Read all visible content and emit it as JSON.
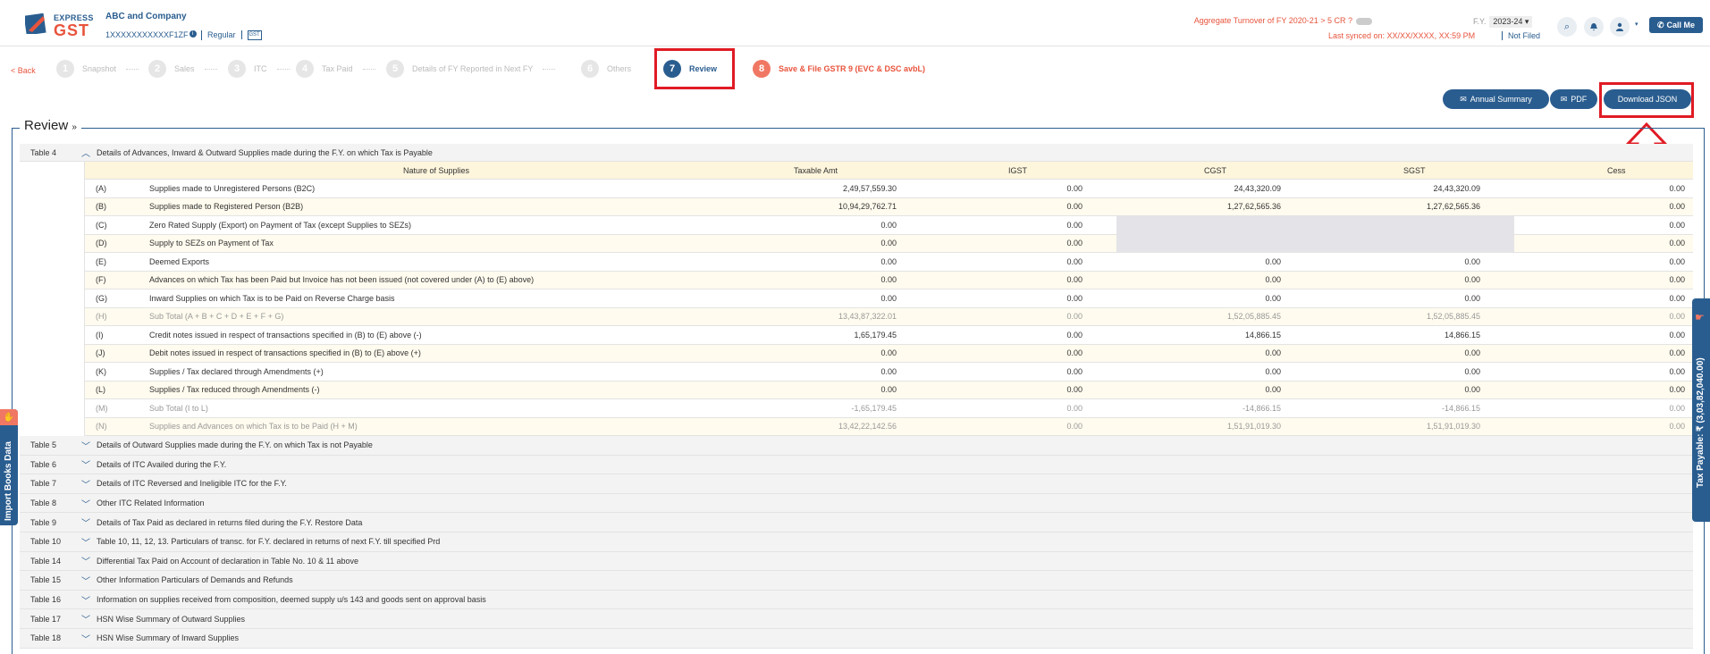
{
  "header": {
    "brand_express": "EXPRESS",
    "brand_gst": "GST",
    "company": "ABC and Company",
    "gstin": "1XXXXXXXXXXXF1ZF",
    "gstin_badge": "i",
    "type": "Regular",
    "gst_mini": "GST",
    "aggregate": "Aggregate Turnover of FY 2020-21 > 5 CR ?",
    "fy_label": "F.Y.",
    "fy_value": "2023-24",
    "synced": "Last synced on: XX/XX/XXXX, XX:59 PM",
    "status": "Not Filed",
    "call_me": "Call Me"
  },
  "stepper": {
    "back": "< Back",
    "steps": [
      {
        "num": "1",
        "label": "Snapshot"
      },
      {
        "num": "2",
        "label": "Sales"
      },
      {
        "num": "3",
        "label": "ITC"
      },
      {
        "num": "4",
        "label": "Tax Paid"
      },
      {
        "num": "5",
        "label": "Details of FY Reported in Next FY"
      },
      {
        "num": "6",
        "label": "Others"
      },
      {
        "num": "7",
        "label": "Review"
      },
      {
        "num": "8",
        "label": "Save & File GSTR 9 (EVC & DSC avbL)"
      }
    ]
  },
  "actions": {
    "annual_summary": "Annual Summary",
    "pdf": "PDF",
    "download_json": "Download JSON"
  },
  "review": {
    "title": "Review",
    "table4": {
      "label": "Table 4",
      "desc": "Details of Advances, Inward & Outward Supplies made during the F.Y. on which Tax is Payable",
      "columns": [
        "Nature of Supplies",
        "Taxable Amt",
        "IGST",
        "CGST",
        "SGST",
        "Cess"
      ],
      "rows": [
        {
          "idx": "(A)",
          "nat": "Supplies made to Unregistered Persons (B2C)",
          "v": [
            "2,49,57,559.30",
            "0.00",
            "24,43,320.09",
            "24,43,320.09",
            "0.00"
          ]
        },
        {
          "idx": "(B)",
          "nat": "Supplies made to Registered Person (B2B)",
          "v": [
            "10,94,29,762.71",
            "0.00",
            "1,27,62,565.36",
            "1,27,62,565.36",
            "0.00"
          ]
        },
        {
          "idx": "(C)",
          "nat": "Zero Rated Supply (Export) on Payment of Tax (except Supplies to SEZs)",
          "v": [
            "0.00",
            "0.00",
            "",
            "",
            "0.00"
          ]
        },
        {
          "idx": "(D)",
          "nat": "Supply to SEZs on Payment of Tax",
          "v": [
            "0.00",
            "0.00",
            "",
            "",
            "0.00"
          ]
        },
        {
          "idx": "(E)",
          "nat": "Deemed Exports",
          "v": [
            "0.00",
            "0.00",
            "0.00",
            "0.00",
            "0.00"
          ]
        },
        {
          "idx": "(F)",
          "nat": "Advances on which Tax has been Paid but Invoice has not been issued (not covered under (A) to (E) above)",
          "v": [
            "0.00",
            "0.00",
            "0.00",
            "0.00",
            "0.00"
          ]
        },
        {
          "idx": "(G)",
          "nat": "Inward Supplies on which Tax is to be Paid on Reverse Charge basis",
          "v": [
            "0.00",
            "0.00",
            "0.00",
            "0.00",
            "0.00"
          ]
        },
        {
          "idx": "(H)",
          "nat": "Sub Total (A + B + C + D + E + F + G)",
          "v": [
            "13,43,87,322.01",
            "0.00",
            "1,52,05,885.45",
            "1,52,05,885.45",
            "0.00"
          ]
        },
        {
          "idx": "(I)",
          "nat": "Credit notes issued in respect of transactions specified in (B) to (E) above (-)",
          "v": [
            "1,65,179.45",
            "0.00",
            "14,866.15",
            "14,866.15",
            "0.00"
          ]
        },
        {
          "idx": "(J)",
          "nat": "Debit notes issued in respect of transactions specified in (B) to (E) above (+)",
          "v": [
            "0.00",
            "0.00",
            "0.00",
            "0.00",
            "0.00"
          ]
        },
        {
          "idx": "(K)",
          "nat": "Supplies / Tax declared through Amendments (+)",
          "v": [
            "0.00",
            "0.00",
            "0.00",
            "0.00",
            "0.00"
          ]
        },
        {
          "idx": "(L)",
          "nat": "Supplies / Tax reduced through Amendments (-)",
          "v": [
            "0.00",
            "0.00",
            "0.00",
            "0.00",
            "0.00"
          ]
        },
        {
          "idx": "(M)",
          "nat": "Sub Total (I to L)",
          "v": [
            "-1,65,179.45",
            "0.00",
            "-14,866.15",
            "-14,866.15",
            "0.00"
          ]
        },
        {
          "idx": "(N)",
          "nat": "Supplies and Advances on which Tax is to be Paid (H + M)",
          "v": [
            "13,42,22,142.56",
            "0.00",
            "1,51,91,019.30",
            "1,51,91,019.30",
            "0.00"
          ]
        }
      ]
    },
    "collapsed": [
      {
        "label": "Table 5",
        "desc": "Details of Outward Supplies made during the F.Y. on which Tax is not Payable"
      },
      {
        "label": "Table 6",
        "desc": "Details of ITC Availed during the F.Y."
      },
      {
        "label": "Table 7",
        "desc": "Details of ITC Reversed and Ineligible ITC for the F.Y."
      },
      {
        "label": "Table 8",
        "desc": "Other ITC Related Information"
      },
      {
        "label": "Table 9",
        "desc": "Details of Tax Paid as declared in returns filed during the F.Y. Restore Data"
      },
      {
        "label": "Table 10",
        "desc": "Table 10, 11, 12, 13. Particulars of transc. for F.Y. declared in returns of next F.Y. till specified Prd"
      },
      {
        "label": "Table 14",
        "desc": "Differential Tax Paid on Account of declaration in Table No. 10 & 11 above"
      },
      {
        "label": "Table 15",
        "desc": "Other Information Particulars of Demands and Refunds"
      },
      {
        "label": "Table 16",
        "desc": "Information on supplies received from composition, deemed supply u/s 143 and goods sent on approval basis"
      },
      {
        "label": "Table 17",
        "desc": "HSN Wise Summary of Outward Supplies"
      },
      {
        "label": "Table 18",
        "desc": "HSN Wise Summary of Inward Supplies"
      }
    ]
  },
  "side": {
    "import_books": "Import Books Data",
    "tax_payable": "Tax Payable: ₹ (3,03,82,040.00)"
  }
}
